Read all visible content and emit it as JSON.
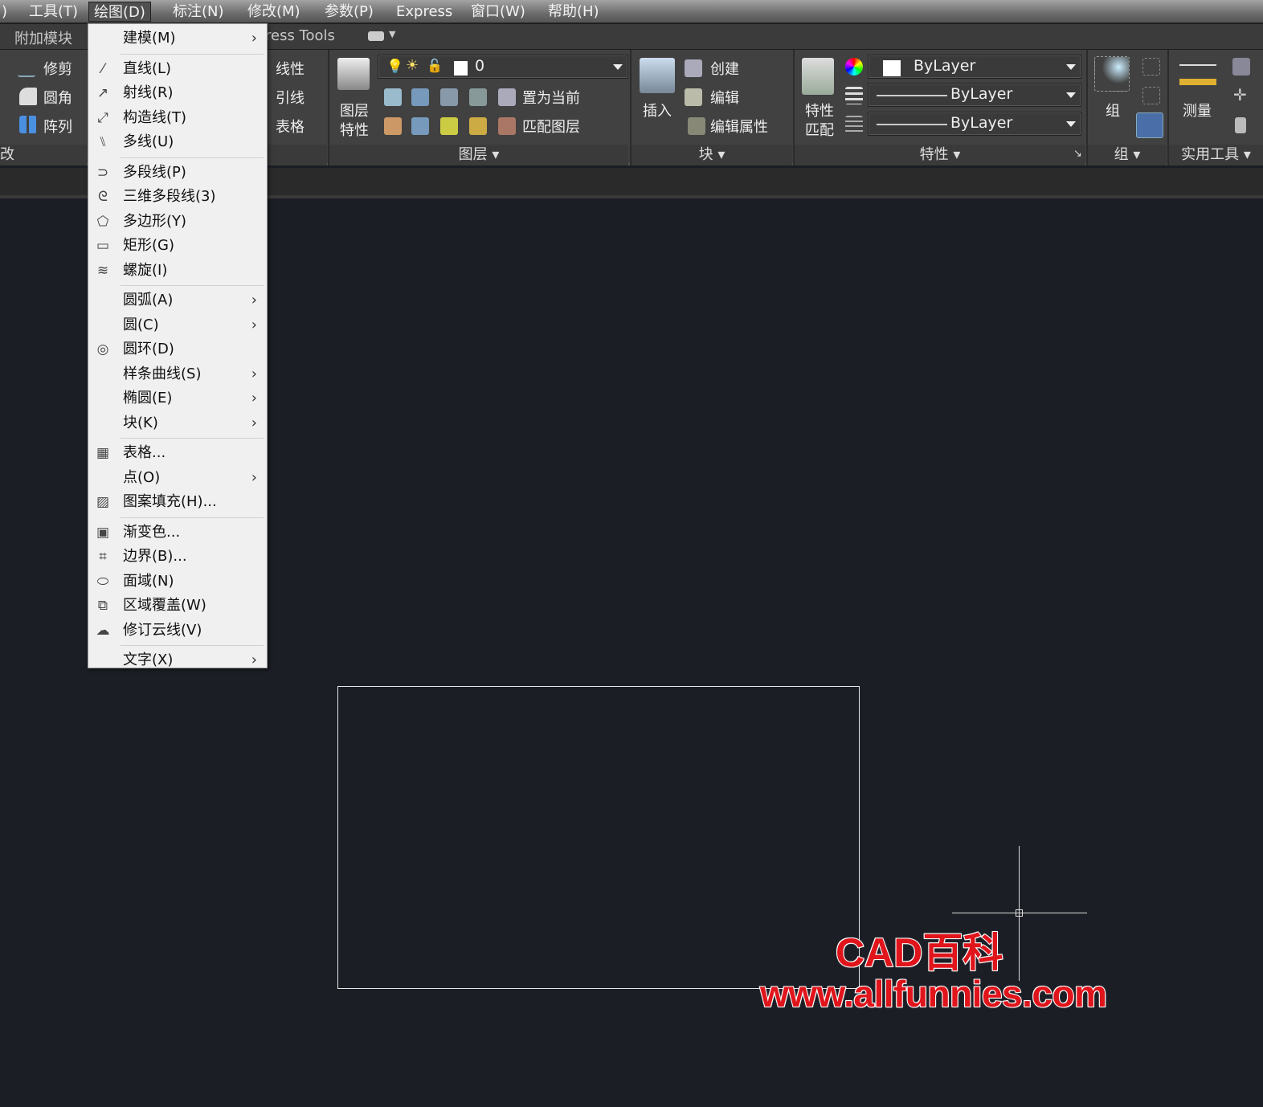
{
  "menubar": {
    "items": [
      ")",
      "工具(T)",
      "绘图(D)",
      "标注(N)",
      "修改(M)",
      "参数(P)",
      "Express",
      "窗口(W)",
      "帮助(H)"
    ],
    "active": "绘图(D)"
  },
  "tabs": {
    "addons": "附加模块",
    "express": "ress Tools"
  },
  "ribbon": {
    "modify": {
      "trim": "修剪",
      "fillet": "圆角",
      "array": "阵列",
      "title": "改"
    },
    "annotation": {
      "linear": "线性",
      "leader": "引线",
      "table": "表格"
    },
    "layers": {
      "props_label": "图层\n特性",
      "props1": "图层",
      "props2": "特性",
      "current_layer": "0",
      "make_current": "置为当前",
      "match_layer": "匹配图层",
      "title": "图层"
    },
    "block": {
      "insert": "插入",
      "create": "创建",
      "edit": "编辑",
      "edit_attr": "编辑属性",
      "title": "块"
    },
    "properties": {
      "match1": "特性",
      "match2": "匹配",
      "color": "ByLayer",
      "linetype": "ByLayer",
      "lineweight": "ByLayer",
      "title": "特性"
    },
    "groups": {
      "group": "组",
      "title": "组"
    },
    "utilities": {
      "measure": "测量",
      "title": "实用工具"
    }
  },
  "draw_menu": [
    {
      "label": "建模(M)",
      "sub": true,
      "icon": ""
    },
    {
      "sep": true
    },
    {
      "label": "直线(L)",
      "icon": "line-icon",
      "glyph": "⁄"
    },
    {
      "label": "射线(R)",
      "icon": "ray-icon",
      "glyph": "↗"
    },
    {
      "label": "构造线(T)",
      "icon": "construction-line-icon",
      "glyph": "⤢"
    },
    {
      "label": "多线(U)",
      "icon": "multiline-icon",
      "glyph": "⑊"
    },
    {
      "sep": true
    },
    {
      "label": "多段线(P)",
      "icon": "polyline-icon",
      "glyph": "⊃"
    },
    {
      "label": "三维多段线(3)",
      "icon": "3d-polyline-icon",
      "glyph": "ᘓ"
    },
    {
      "label": "多边形(Y)",
      "icon": "polygon-icon",
      "glyph": "⬠"
    },
    {
      "label": "矩形(G)",
      "icon": "rectangle-icon",
      "glyph": "▭"
    },
    {
      "label": "螺旋(I)",
      "icon": "helix-icon",
      "glyph": "≋"
    },
    {
      "sep": true
    },
    {
      "label": "圆弧(A)",
      "sub": true,
      "icon": ""
    },
    {
      "label": "圆(C)",
      "sub": true,
      "icon": ""
    },
    {
      "label": "圆环(D)",
      "icon": "donut-icon",
      "glyph": "◎"
    },
    {
      "label": "样条曲线(S)",
      "sub": true,
      "icon": ""
    },
    {
      "label": "椭圆(E)",
      "sub": true,
      "icon": ""
    },
    {
      "label": "块(K)",
      "sub": true,
      "icon": ""
    },
    {
      "sep": true
    },
    {
      "label": "表格...",
      "icon": "table-icon",
      "glyph": "▦"
    },
    {
      "label": "点(O)",
      "sub": true,
      "icon": ""
    },
    {
      "label": "图案填充(H)...",
      "icon": "hatch-icon",
      "glyph": "▨"
    },
    {
      "sep": true
    },
    {
      "label": "渐变色...",
      "icon": "gradient-icon",
      "glyph": "▣"
    },
    {
      "label": "边界(B)...",
      "icon": "boundary-icon",
      "glyph": "⌗"
    },
    {
      "label": "面域(N)",
      "icon": "region-icon",
      "glyph": "⬭"
    },
    {
      "label": "区域覆盖(W)",
      "icon": "wipeout-icon",
      "glyph": "⧉"
    },
    {
      "label": "修订云线(V)",
      "icon": "revision-cloud-icon",
      "glyph": "☁"
    },
    {
      "sep": true
    },
    {
      "label": "文字(X)",
      "sub": true,
      "icon": ""
    }
  ],
  "watermark": {
    "line1": "CAD百科",
    "line2": "www.allfunnies.com"
  },
  "colors": {
    "canvas": "#1b1e25",
    "ribbon": "#414141",
    "menu": "#f0f0f0",
    "watermark": "#e0141b"
  }
}
